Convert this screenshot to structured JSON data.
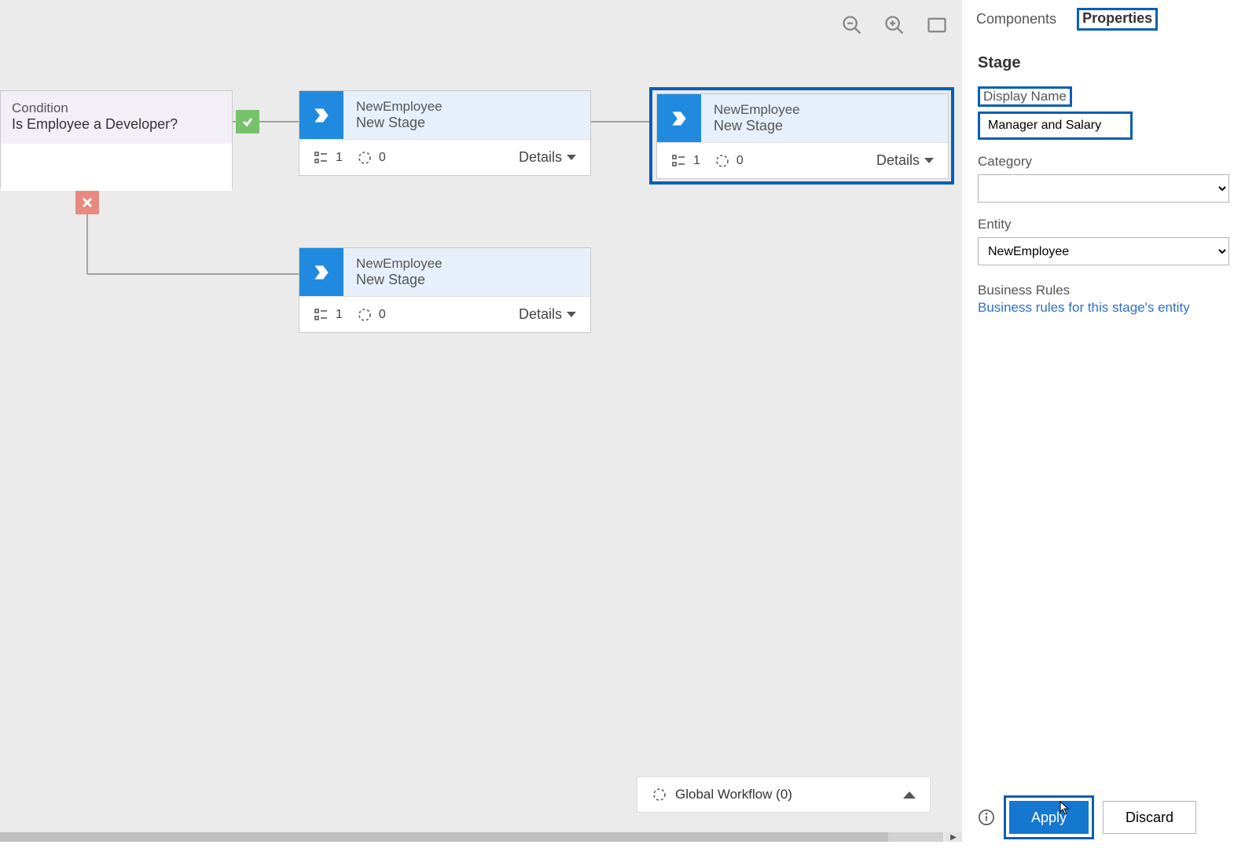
{
  "canvas": {
    "tools": {
      "zoom_out": "zoom-out",
      "zoom_in": "zoom-in",
      "fit": "fit-to-screen"
    },
    "condition": {
      "title_label": "Condition",
      "text": "Is Employee a Developer?"
    },
    "stage_yes": {
      "entity": "NewEmployee",
      "name": "New Stage",
      "steps_count": "1",
      "triggers_count": "0",
      "details_label": "Details"
    },
    "stage_selected": {
      "entity": "NewEmployee",
      "name": "New Stage",
      "steps_count": "1",
      "triggers_count": "0",
      "details_label": "Details"
    },
    "stage_no": {
      "entity": "NewEmployee",
      "name": "New Stage",
      "steps_count": "1",
      "triggers_count": "0",
      "details_label": "Details"
    },
    "global_workflow": {
      "label": "Global Workflow (0)"
    }
  },
  "side": {
    "tabs": {
      "components": "Components",
      "properties": "Properties"
    },
    "section_title": "Stage",
    "display_name_label": "Display Name",
    "display_name_value": "Manager and Salary",
    "category_label": "Category",
    "category_value": "",
    "entity_label": "Entity",
    "entity_value": "NewEmployee",
    "business_rules_label": "Business Rules",
    "business_rules_link": "Business rules for this stage's entity",
    "apply_label": "Apply",
    "discard_label": "Discard"
  }
}
